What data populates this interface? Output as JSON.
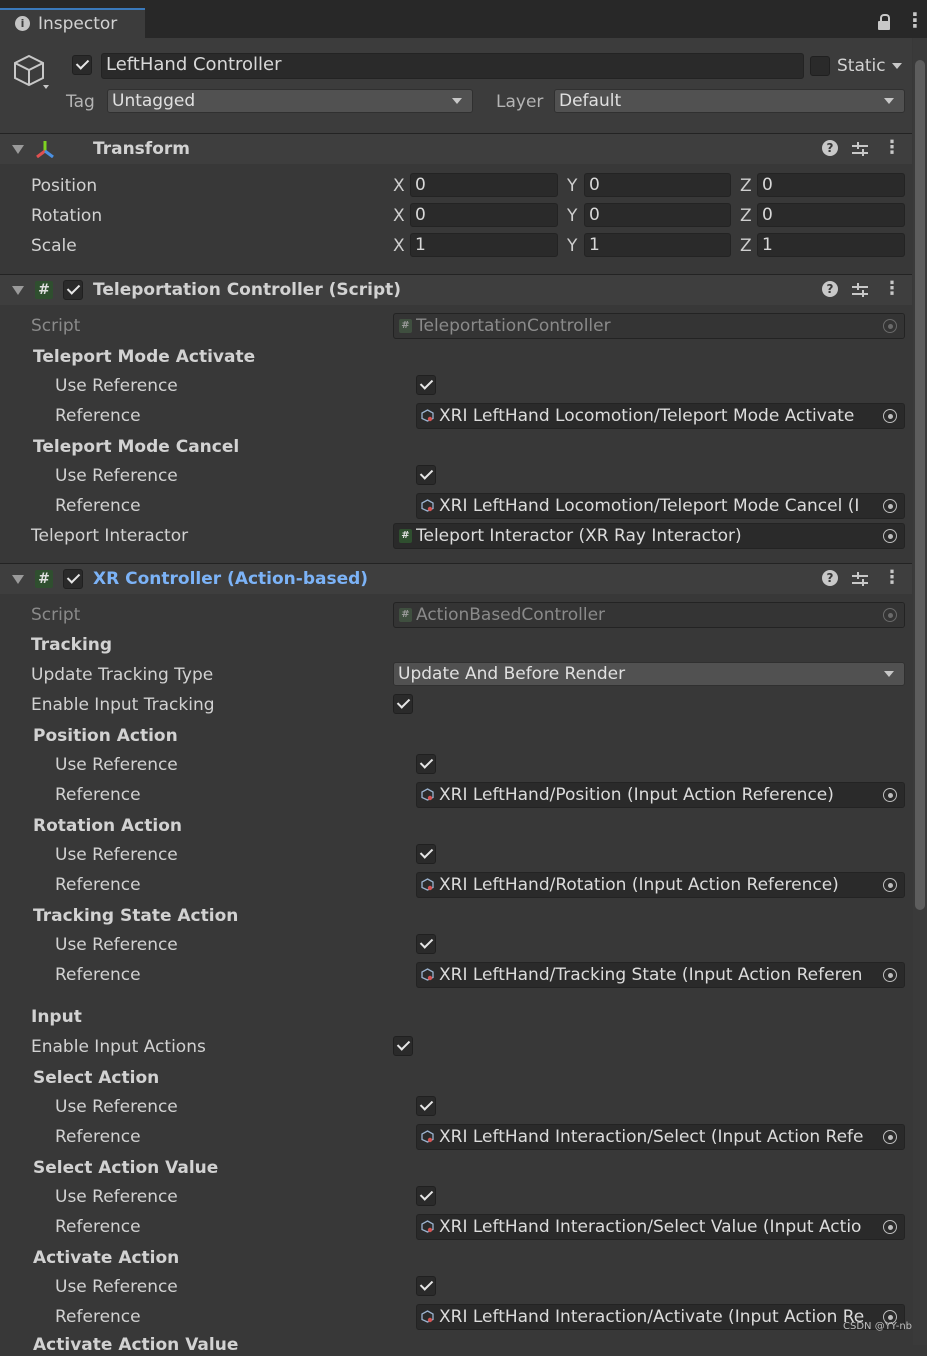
{
  "window": {
    "tab_title": "Inspector",
    "tab_icon": "info-icon",
    "lock_icon": "lock-icon",
    "menu_icon": "kebab-menu-icon"
  },
  "gameobject": {
    "active": true,
    "name": "LeftHand Controller",
    "static_label": "Static",
    "static_checked": false,
    "tag_label": "Tag",
    "tag_value": "Untagged",
    "layer_label": "Layer",
    "layer_value": "Default"
  },
  "transform": {
    "title": "Transform",
    "rows": [
      {
        "label": "Position",
        "x": "0",
        "y": "0",
        "z": "0"
      },
      {
        "label": "Rotation",
        "x": "0",
        "y": "0",
        "z": "0"
      },
      {
        "label": "Scale",
        "x": "1",
        "y": "1",
        "z": "1"
      }
    ],
    "axis_x": "X",
    "axis_y": "Y",
    "axis_z": "Z"
  },
  "teleport": {
    "title": "Teleportation Controller (Script)",
    "enabled": true,
    "script_label": "Script",
    "script_value": "TeleportationController",
    "activate_group": "Teleport Mode Activate",
    "cancel_group": "Teleport Mode Cancel",
    "use_reference": "Use Reference",
    "reference": "Reference",
    "activate_ref": "XRI LeftHand Locomotion/Teleport Mode Activate",
    "cancel_ref": "XRI LeftHand Locomotion/Teleport Mode Cancel (I",
    "interactor_label": "Teleport Interactor",
    "interactor_value": "Teleport Interactor (XR Ray Interactor)"
  },
  "xr": {
    "title": "XR Controller (Action-based)",
    "title_color": "#7cb3f7",
    "enabled": true,
    "script_label": "Script",
    "script_value": "ActionBasedController",
    "tracking_header": "Tracking",
    "update_tracking_label": "Update Tracking Type",
    "update_tracking_value": "Update And Before Render",
    "enable_input_tracking": "Enable Input Tracking",
    "position_action": "Position Action",
    "position_ref": "XRI LeftHand/Position (Input Action Reference)",
    "rotation_action": "Rotation Action",
    "rotation_ref": "XRI LeftHand/Rotation (Input Action Reference)",
    "tracking_state_action": "Tracking State Action",
    "tracking_state_ref": "XRI LeftHand/Tracking State (Input Action Referen",
    "input_header": "Input",
    "enable_input_actions": "Enable Input Actions",
    "select_action": "Select Action",
    "select_ref": "XRI LeftHand Interaction/Select (Input Action Refe",
    "select_value_action": "Select Action Value",
    "select_value_ref": "XRI LeftHand Interaction/Select Value (Input Actio",
    "activate_action": "Activate Action",
    "activate_ref": "XRI LeftHand Interaction/Activate (Input Action Re",
    "activate_value_action": "Activate Action Value",
    "use_reference": "Use Reference",
    "reference": "Reference"
  },
  "watermark": "CSDN @YY-nb"
}
